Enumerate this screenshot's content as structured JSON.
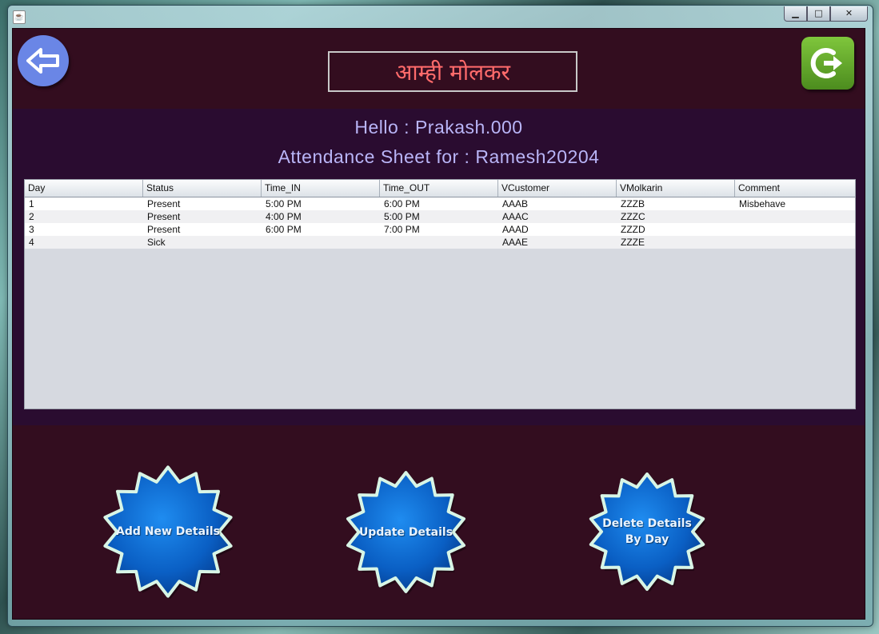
{
  "window": {
    "icon_glyph": "☕",
    "controls": {
      "minimize": "▁",
      "maximize": "□",
      "close": "✕"
    }
  },
  "header": {
    "brand": "आम्ही मोलकर",
    "back_icon": "arrow-left-icon",
    "logout_icon": "logout-icon"
  },
  "greeting": {
    "hello": "Hello : Prakash.000",
    "sheet_for": "Attendance Sheet for : Ramesh20204"
  },
  "table": {
    "columns": [
      "Day",
      "Status",
      "Time_IN",
      "Time_OUT",
      "VCustomer",
      "VMolkarin",
      "Comment"
    ],
    "rows": [
      [
        "1",
        "Present",
        "5:00 PM",
        "6:00 PM",
        "AAAB",
        "ZZZB",
        "Misbehave"
      ],
      [
        "2",
        "Present",
        "4:00 PM",
        "5:00 PM",
        "AAAC",
        "ZZZC",
        ""
      ],
      [
        "3",
        "Present",
        "6:00 PM",
        "7:00 PM",
        "AAAD",
        "ZZZD",
        ""
      ],
      [
        "4",
        "Sick",
        "",
        "",
        "AAAE",
        "ZZZE",
        ""
      ]
    ]
  },
  "actions": {
    "add": {
      "line1": "Add New Details",
      "line2": ""
    },
    "update": {
      "line1": "Update Details",
      "line2": ""
    },
    "delete": {
      "line1": "Delete Details",
      "line2": "By Day"
    }
  },
  "colors": {
    "background": "#330d1f",
    "band": "#2a0c30",
    "brand_text": "#ff6b6b",
    "greeting_text": "#b9b5f7",
    "star_fill": "#0a6fd6",
    "star_outline": "#d8f5e6"
  }
}
